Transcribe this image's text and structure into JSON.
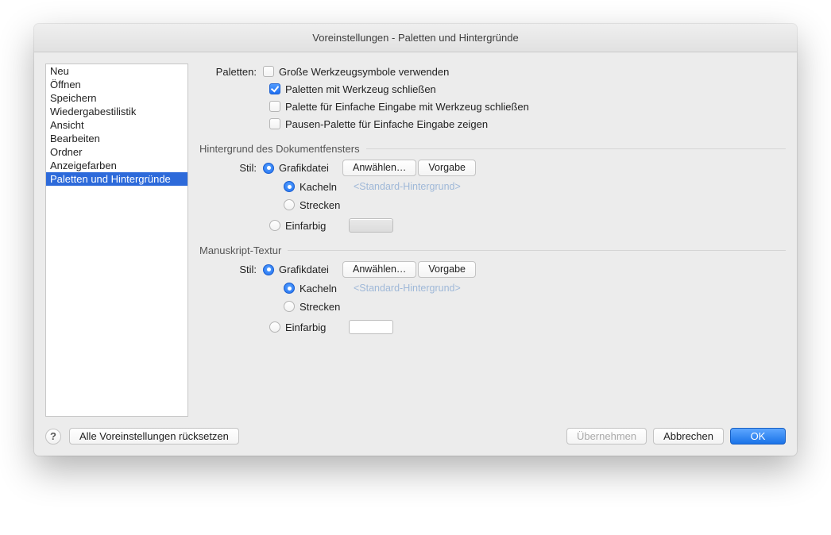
{
  "window": {
    "title": "Voreinstellungen - Paletten und Hintergründe"
  },
  "sidebar": {
    "items": [
      "Neu",
      "Öffnen",
      "Speichern",
      "Wiedergabestilistik",
      "Ansicht",
      "Bearbeiten",
      "Ordner",
      "Anzeigefarben",
      "Paletten und Hintergründe"
    ],
    "selected_index": 8
  },
  "palettes": {
    "label": "Paletten:",
    "opts": [
      {
        "label": "Große Werkzeugsymbole verwenden",
        "checked": false
      },
      {
        "label": "Paletten mit Werkzeug schließen",
        "checked": true
      },
      {
        "label": "Palette für Einfache Eingabe mit Werkzeug schließen",
        "checked": false
      },
      {
        "label": "Pausen-Palette für Einfache Eingabe zeigen",
        "checked": false
      }
    ]
  },
  "background": {
    "heading": "Hintergrund des Dokumentfensters",
    "style_label": "Stil:",
    "graphic_label": "Grafikdatei",
    "tile_label": "Kacheln",
    "stretch_label": "Strecken",
    "solid_label": "Einfarbig",
    "select_btn": "Anwählen…",
    "default_btn": "Vorgabe",
    "hint": "<Standard-Hintergrund>"
  },
  "manuscript": {
    "heading": "Manuskript-Textur",
    "style_label": "Stil:",
    "graphic_label": "Grafikdatei",
    "tile_label": "Kacheln",
    "stretch_label": "Strecken",
    "solid_label": "Einfarbig",
    "select_btn": "Anwählen…",
    "default_btn": "Vorgabe",
    "hint": "<Standard-Hintergrund>"
  },
  "footer": {
    "help_glyph": "?",
    "reset": "Alle Voreinstellungen rücksetzen",
    "apply": "Übernehmen",
    "cancel": "Abbrechen",
    "ok": "OK"
  }
}
